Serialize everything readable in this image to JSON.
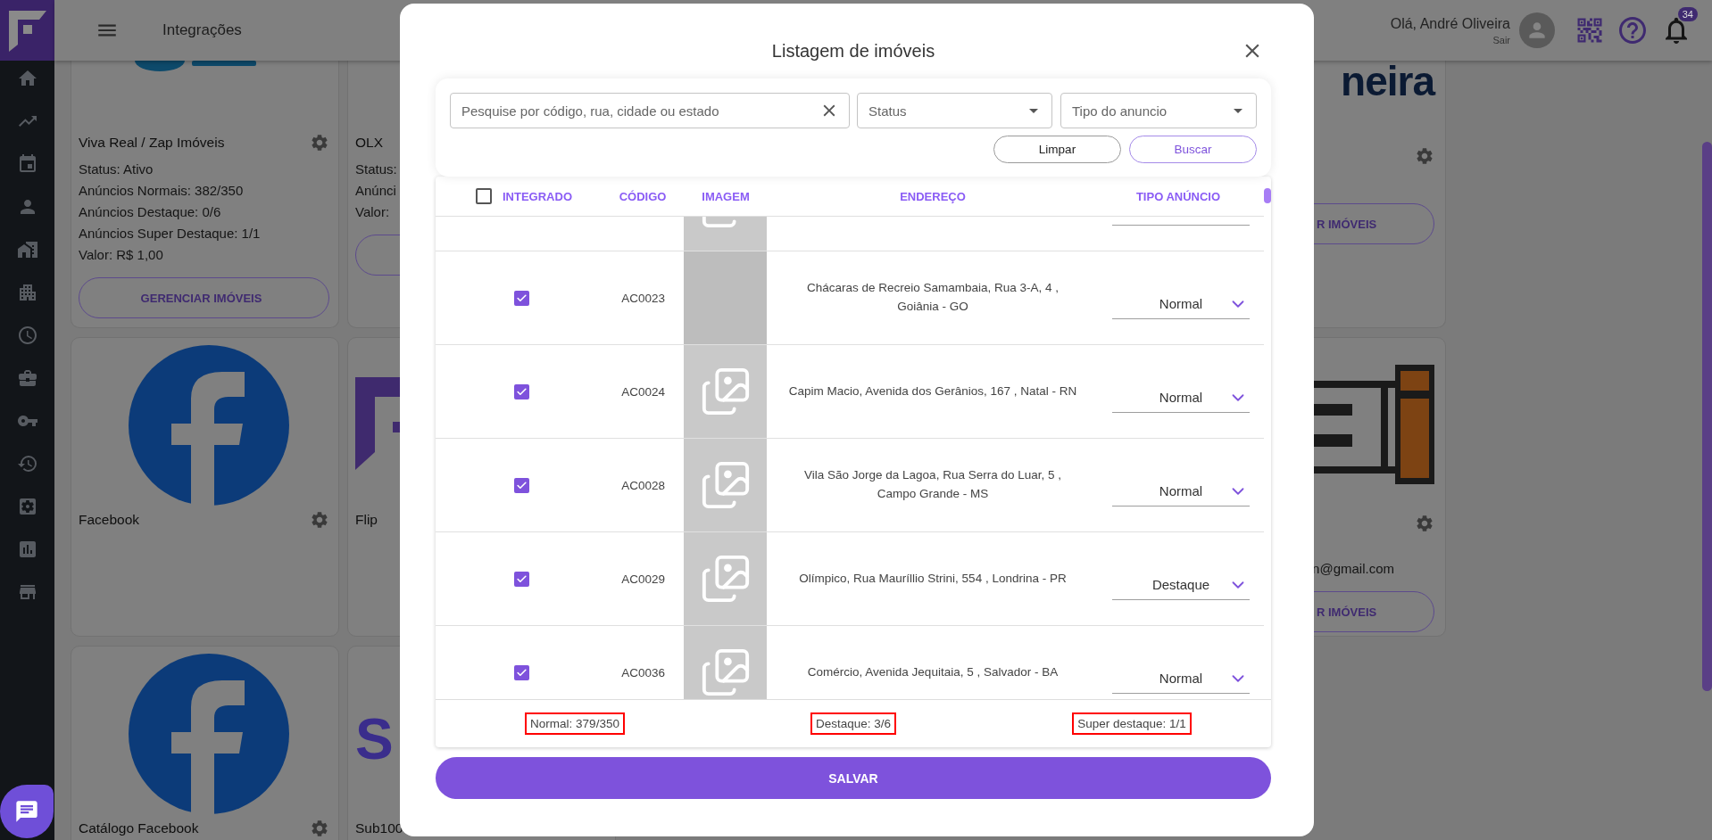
{
  "header": {
    "title": "Integrações",
    "greeting": "Olá, André Oliveira",
    "logout": "Sair",
    "notification_count": "34"
  },
  "integrations": [
    {
      "kind": "full",
      "logo": {
        "kind": "wave"
      },
      "title": "Viva Real / Zap Imóveis",
      "lines": [
        "Status: Ativo",
        "Anúncios Normais: 382/350",
        "Anúncios Destaque: 0/6",
        "Anúncios Super Destaque: 1/1",
        "Valor: R$ 1,00"
      ],
      "button": "GERENCIAR IMÓVEIS"
    },
    {
      "kind": "left",
      "title": "OLX",
      "lines": [
        "Status:",
        "Anúnci",
        "Valor:"
      ],
      "outline_button": true
    },
    {
      "kind": "right",
      "logo_text": "neira",
      "button": "R IMÓVEIS"
    },
    {
      "kind": "full",
      "logo": {
        "kind": "circle-f"
      },
      "title": "Facebook"
    },
    {
      "kind": "left",
      "logo": {
        "kind": "corner-mark"
      },
      "title": "Flip"
    },
    {
      "kind": "right",
      "logo": {
        "kind": "bars-box"
      },
      "email": "n@gmail.com",
      "button": "R IMÓVEIS"
    },
    {
      "kind": "full",
      "logo": {
        "kind": "circle-f"
      },
      "title": "Catálogo Facebook"
    },
    {
      "kind": "left",
      "logo_text": "S",
      "title": "Sub100"
    }
  ],
  "modal": {
    "title": "Listagem de imóveis",
    "search": {
      "placeholder": "Pesquise por código, rua, cidade ou estado"
    },
    "filters": [
      {
        "placeholder": "Status"
      },
      {
        "placeholder": "Tipo do anuncio"
      }
    ],
    "buttons": [
      {
        "label": "Limpar",
        "kind": "plain"
      },
      {
        "label": "Buscar",
        "kind": "primary"
      }
    ],
    "table": {
      "columns": [
        "INTEGRADO",
        "CÓDIGO",
        "IMAGEM",
        "ENDEREÇO",
        "TIPO ANÚNCIO"
      ],
      "select_all": false,
      "rows": [
        {
          "kind": "cut",
          "thumbnail": {
            "kind": "placeholder"
          }
        },
        {
          "kind": "full",
          "checked": true,
          "code": "AC0023",
          "thumbnail": {
            "kind": "blank"
          },
          "address": "Chácaras de Recreio Samambaia, Rua 3-A, 4 , Goiânia - GO",
          "type": "Normal"
        },
        {
          "kind": "full",
          "checked": true,
          "code": "AC0024",
          "thumbnail": {
            "kind": "placeholder"
          },
          "address": "Capim Macio, Avenida dos Gerânios, 167 , Natal - RN",
          "type": "Normal"
        },
        {
          "kind": "full",
          "checked": true,
          "code": "AC0028",
          "thumbnail": {
            "kind": "placeholder"
          },
          "address": "Vila São Jorge da Lagoa, Rua Serra do Luar, 5 , Campo Grande - MS",
          "type": "Normal"
        },
        {
          "kind": "full",
          "checked": true,
          "code": "AC0029",
          "thumbnail": {
            "kind": "placeholder"
          },
          "address": "Olímpico, Rua Mauríllio Strini, 554 , Londrina - PR",
          "type": "Destaque"
        },
        {
          "kind": "full",
          "checked": true,
          "code": "AC0036",
          "thumbnail": {
            "kind": "placeholder"
          },
          "address": "Comércio, Avenida Jequitaia, 5 , Salvador - BA",
          "type": "Normal"
        }
      ]
    },
    "totals": [
      "Normal: 379/350",
      "Destaque: 3/6",
      "Super destaque: 1/1"
    ],
    "save": "SALVAR"
  }
}
